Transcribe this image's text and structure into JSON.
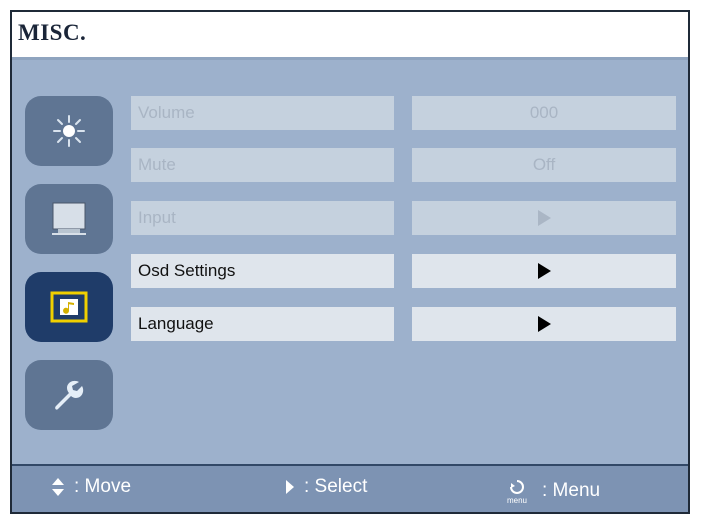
{
  "title": "MISC.",
  "sidebar": {
    "items": [
      {
        "name": "brightness",
        "icon": "brightness-icon",
        "active": false
      },
      {
        "name": "display",
        "icon": "monitor-icon",
        "active": false
      },
      {
        "name": "audio",
        "icon": "music-note-icon",
        "active": true
      },
      {
        "name": "settings",
        "icon": "wrench-icon",
        "active": false
      }
    ]
  },
  "menu": {
    "rows": [
      {
        "label": "Volume",
        "value": "000",
        "enabled": false
      },
      {
        "label": "Mute",
        "value": "Off",
        "enabled": false
      },
      {
        "label": "Input",
        "value": "",
        "enabled": false,
        "value_icon": "arrow-right-icon"
      },
      {
        "label": "Osd Settings",
        "value": "",
        "enabled": true,
        "value_icon": "arrow-right-icon"
      },
      {
        "label": "Language",
        "value": "",
        "enabled": true,
        "value_icon": "arrow-right-icon"
      }
    ]
  },
  "footer": {
    "move_label": ": Move",
    "select_label": ": Select",
    "menu_label": ": Menu",
    "menu_icon_text": "menu"
  },
  "colors": {
    "panel_bg": "#9db1cc",
    "active_icon_bg": "#1f3c69",
    "inactive_icon_bg": "#5f7593",
    "footer_bg": "#7d93b3",
    "highlight_yellow": "#f0d000"
  }
}
